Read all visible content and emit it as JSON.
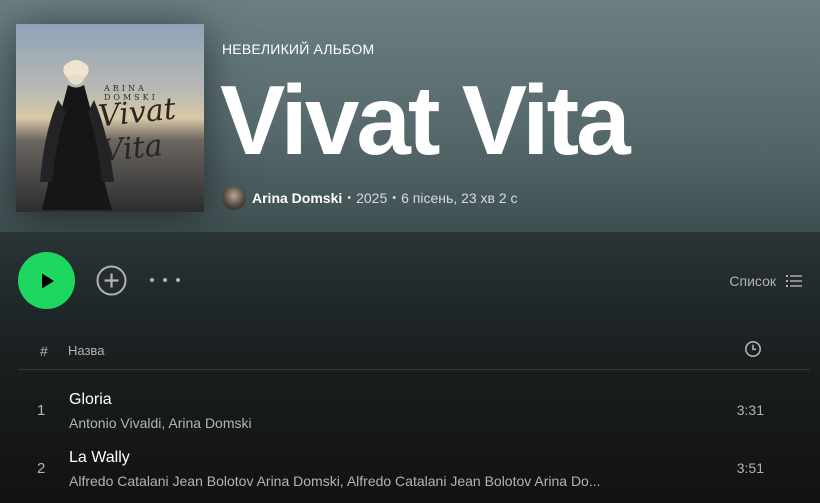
{
  "album": {
    "type_label": "НЕВЕЛИКИЙ АЛЬБОМ",
    "title": "Vivat Vita",
    "cover": {
      "artist_text": "ARINA DOMSKI",
      "script_text": "Vivat Vita"
    },
    "artist": "Arina Domski",
    "year": "2025",
    "summary": "6 пісень, 23 хв 2 с"
  },
  "controls": {
    "play_icon": "play-icon",
    "add_icon": "plus-circle-icon",
    "more_icon": "more-horizontal-icon",
    "view_label": "Список",
    "view_icon": "list-icon"
  },
  "table": {
    "headers": {
      "number": "#",
      "title": "Назва",
      "duration_icon": "clock-icon"
    },
    "tracks": [
      {
        "number": "1",
        "title": "Gloria",
        "artists": "Antonio Vivaldi, Arina Domski",
        "duration": "3:31"
      },
      {
        "number": "2",
        "title": "La Wally",
        "artists": "Alfredo Catalani Jean Bolotov Arina Domski, Alfredo Catalani Jean Bolotov Arina Do...",
        "duration": "3:51"
      }
    ]
  },
  "colors": {
    "accent": "#1ed760",
    "header_bg": "#5f7376",
    "text_secondary": "#b3b3b3"
  }
}
